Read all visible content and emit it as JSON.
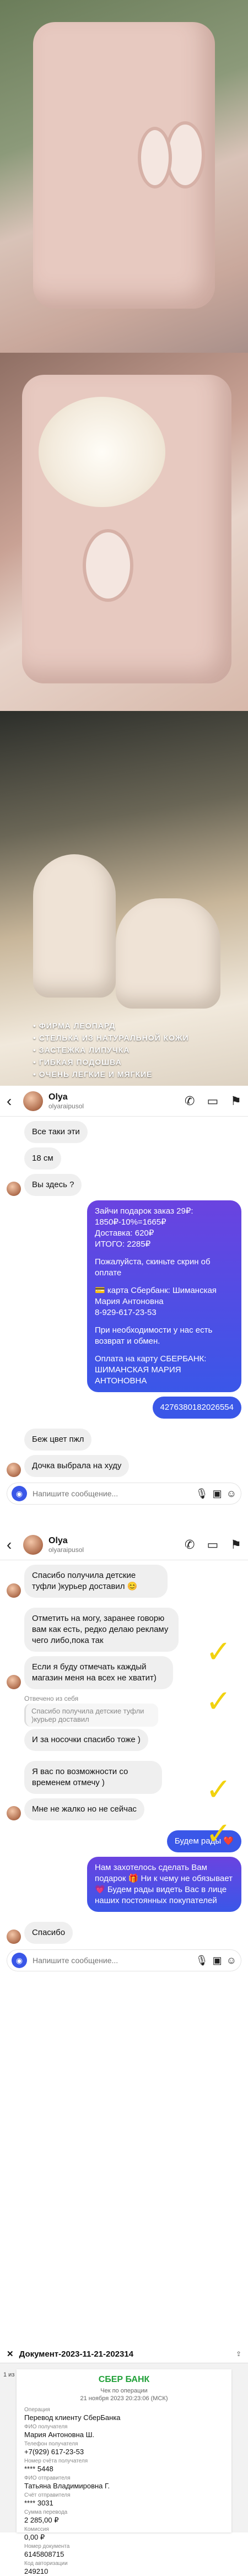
{
  "photo3": {
    "features": [
      "ФИРМА ЛЕОПАРД",
      "СТЕЛЬКА ИЗ НАТУРАЛЬНОЙ КОЖИ",
      "ЗАСТЕЖКА ЛИПУЧКА",
      "ГИБКАЯ ПОДОШВА",
      "ОЧЕНЬ ЛЕГКИЕ И МЯГКИЕ"
    ]
  },
  "chat1": {
    "contact": {
      "name": "Olya",
      "username": "olyaraipusol"
    },
    "messages": {
      "m1": "Все таки эти",
      "m2": "18 см",
      "m3": "Вы здесь ?",
      "m4_lines": [
        "Зайчи подарок заказ 29₽:",
        "1850₽-10%=1665₽",
        "Доставка: 620₽",
        "ИТОГО: 2285₽"
      ],
      "m4_p2": "Пожалуйста, скиньте скрин об оплате",
      "m4_p3": "💳 карта Сбербанк: Шиманская Мария Антоновна",
      "m4_phone": "8-929-617-23-53",
      "m4_p4": "При необходимости у нас есть возврат и обмен.",
      "m4_p5": "Оплата на карту СБЕРБАНК: ШИМАНСКАЯ МАРИЯ АНТОНОВНА",
      "m5": "4276380182026554",
      "m6": "Беж цвет пжл",
      "m7": "Дочка выбрала на худу"
    },
    "composer_placeholder": "Напишите сообщение..."
  },
  "chat2": {
    "contact": {
      "name": "Olya",
      "username": "olyaraipusol"
    },
    "messages": {
      "m1": "Спасибо получила детские туфли )курьер доставил 😊",
      "m2": "Отметить на могу, заранее говорю вам как есть, редко делаю рекламу чего либо,пока так",
      "m3": "Если я буду отмечать каждый магазин меня на всех не хватит)",
      "reply_caption": "Отвечено из себя",
      "reply_quote": "Спасибо получила детские туфли )курьер доставил",
      "m4": "И за носочки спасибо тоже )",
      "m5": "Я вас по возможности со временем отмечу )",
      "m6": "Мне не жалко но не сейчас",
      "m7": "Будем рады ❤️",
      "m8": "Нам захотелось сделать Вам подарок 🎁 Ни к чему не обязывает 💗 Будем рады видеть Вас в лице наших постоянных покупателей",
      "m9": "Спасибо"
    },
    "composer_placeholder": "Напишите сообщение..."
  },
  "receipt": {
    "doc_title": "Документ-2023-11-21-202314",
    "page": "1 из 1",
    "bank": "СБЕР БАНК",
    "head_line1": "Чек по операции",
    "head_line2": "21 ноября 2023 20:23:06 (МСК)",
    "fields": [
      {
        "label": "Операция",
        "value": "Перевод клиенту СберБанка"
      },
      {
        "label": "ФИО получателя",
        "value": "Мария Антоновна Ш."
      },
      {
        "label": "Телефон получателя",
        "value": "+7(929) 617-23-53"
      },
      {
        "label": "Номер счёта получателя",
        "value": "**** 5448"
      },
      {
        "label": "ФИО отправителя",
        "value": "Татьяна Владимировна Г."
      },
      {
        "label": "Счёт отправителя",
        "value": "**** 3031"
      },
      {
        "label": "Сумма перевода",
        "value": "2 285,00 ₽"
      },
      {
        "label": "Комиссия",
        "value": "0,00 ₽"
      },
      {
        "label": "Номер документа",
        "value": "6145808715"
      },
      {
        "label": "Код авторизации",
        "value": "249210"
      }
    ]
  },
  "colors": {
    "sent": "#3a57e8",
    "received": "#efefef",
    "sber_green": "#21a038",
    "check_mark": "#f1d20f"
  }
}
